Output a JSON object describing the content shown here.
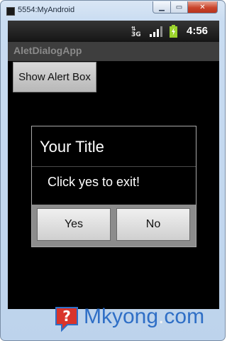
{
  "window": {
    "title": "5554:MyAndroid",
    "controls": [
      "minimize",
      "maximize",
      "close"
    ]
  },
  "statusbar": {
    "network": "3G",
    "time": "4:56",
    "icons": [
      "data-arrows-icon",
      "signal-bars-icon",
      "battery-charging-icon"
    ]
  },
  "app": {
    "title": "AletDialogApp",
    "show_button_label": "Show Alert Box"
  },
  "dialog": {
    "title": "Your Title",
    "message": "Click yes to exit!",
    "yes_label": "Yes",
    "no_label": "No"
  },
  "watermark": {
    "brand": "Mkyong",
    "dot": ".",
    "tld": "com"
  },
  "colors": {
    "brand_blue": "#2f6fc6",
    "logo_red": "#d9342b",
    "screen_bg": "#000000",
    "close_button": "#c9452c"
  }
}
